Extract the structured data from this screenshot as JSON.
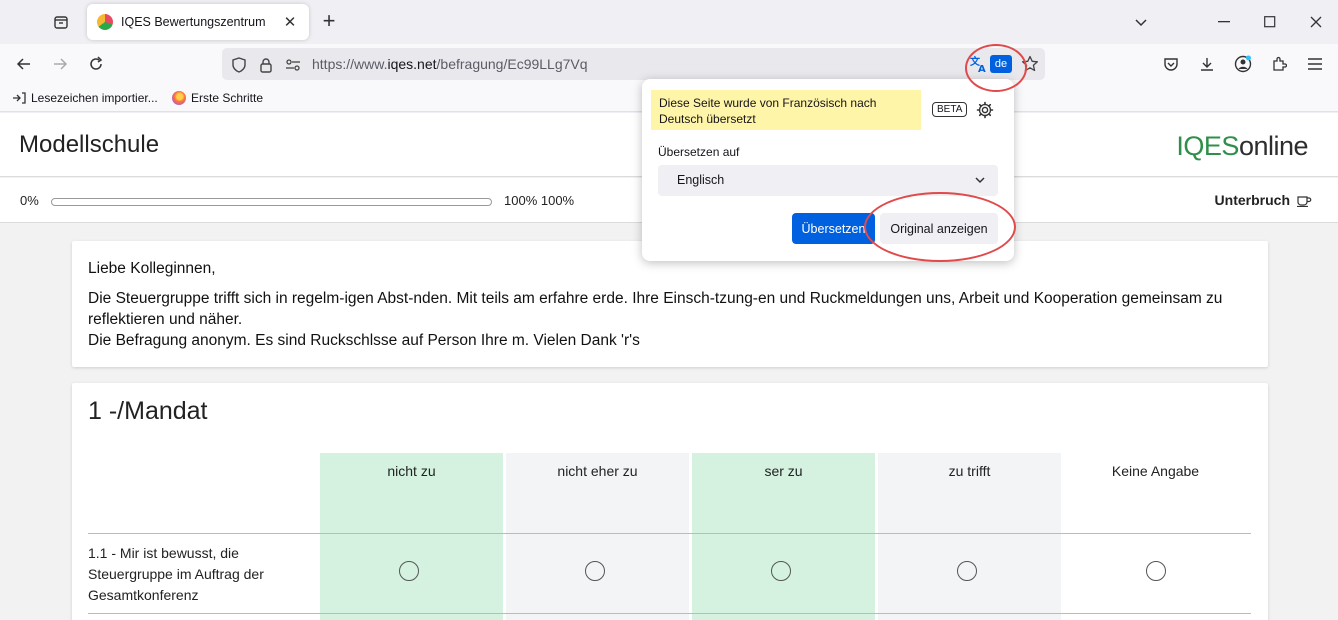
{
  "browser": {
    "tab_title": "IQES Bewertungszentrum",
    "tab_close": "✕",
    "new_tab": "+",
    "url_prefix": "https://www.",
    "url_domain": "iqes.net",
    "url_path": "/befragung/Ec99LLg7Vq",
    "translate_lang_badge": "de",
    "bookmarks": [
      {
        "label": "Lesezeichen importier..."
      },
      {
        "label": "Erste Schritte"
      }
    ]
  },
  "translation_popup": {
    "notice": "Diese Seite wurde von Französisch nach Deutsch übersetzt",
    "beta_label": "BETA",
    "translate_to_label": "Übersetzen auf",
    "selected_language": "Englisch",
    "translate_button": "Übersetzen",
    "show_original_button": "Original anzeigen"
  },
  "page": {
    "school_name": "Modellschule",
    "logo_part1": "IQES",
    "logo_part2": "online",
    "progress_start": "0%",
    "progress_end": "100% 100%",
    "progress_fraction": 0,
    "pause_label": "Unterbruch",
    "intro": {
      "greeting": "Liebe Kolleginnen,",
      "line1": "Die Steuergruppe trifft sich in regelm-igen Abst-nden. Mit teils am erfahre erde. Ihre Einsch-tzung-en und Ruckmeldungen uns, Arbeit und Kooperation gemeinsam zu reflektieren und näher.",
      "line2": "Die Befragung anonym. Es sind Ruckschlsse auf Person Ihre m. Vielen Dank 'r's"
    },
    "section": {
      "title": "1 -/Mandat",
      "columns": [
        "nicht zu",
        "nicht eher zu",
        "ser zu",
        "zu trifft",
        "Keine Angabe"
      ],
      "question": "1.1 - Mir ist bewusst, die Steuergruppe im Auftrag der Gesamtkonferenz"
    }
  },
  "colors": {
    "accent_blue": "#0061e0",
    "notice_yellow": "#fff5a8",
    "col_green": "#d4f2df",
    "col_grey": "#f2f4f5",
    "logo_green": "#2f8f4a",
    "annotation_red": "#e04a4a"
  }
}
